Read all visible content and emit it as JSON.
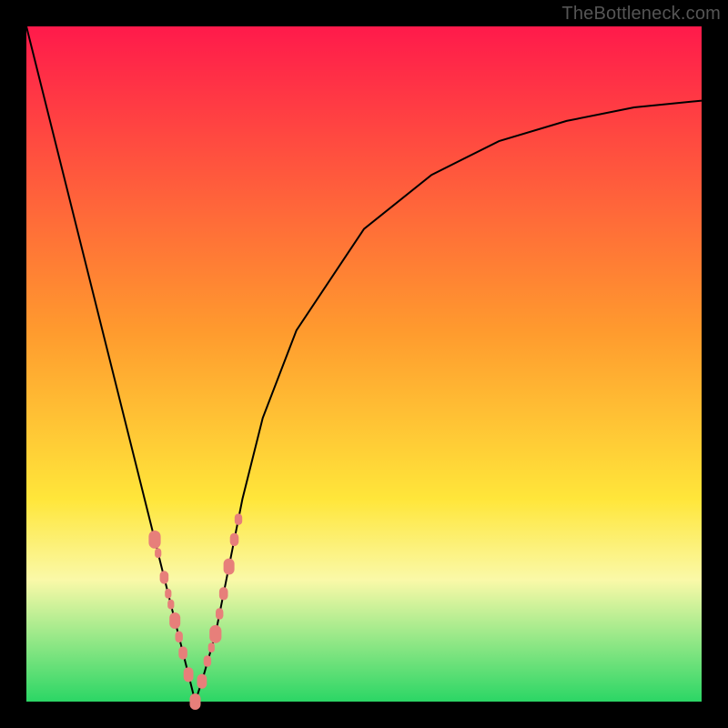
{
  "watermark": "TheBottleneck.com",
  "colors": {
    "top": "#ff1a4b",
    "orange": "#ff9a2e",
    "yellow": "#ffe63a",
    "lightyellow": "#faf9a8",
    "green": "#2bd665",
    "marker": "#e77f7a",
    "curve": "#000000"
  },
  "chart_data": {
    "type": "line",
    "title": "",
    "xlabel": "",
    "ylabel": "",
    "xlim": [
      0,
      100
    ],
    "ylim": [
      0,
      100
    ],
    "x_min_point": 25,
    "series": [
      {
        "name": "bottleneck-curve",
        "x": [
          0,
          5,
          10,
          14,
          18,
          20,
          22,
          24,
          25,
          26,
          28,
          30,
          32,
          35,
          40,
          50,
          60,
          70,
          80,
          90,
          100
        ],
        "values": [
          100,
          80,
          60,
          44,
          28,
          20,
          12,
          4,
          0,
          3,
          10,
          20,
          30,
          42,
          55,
          70,
          78,
          83,
          86,
          88,
          89
        ]
      }
    ],
    "markers": {
      "name": "highlighted-points",
      "x": [
        19.0,
        19.5,
        20.4,
        21.0,
        21.4,
        22.0,
        22.6,
        23.2,
        24.0,
        25.0,
        26.0,
        26.8,
        27.4,
        28.0,
        28.6,
        29.2,
        30.0,
        30.8,
        31.4
      ],
      "values": [
        24.0,
        22.0,
        18.4,
        16.0,
        14.4,
        12.0,
        9.6,
        7.2,
        4.0,
        0.0,
        3.0,
        6.0,
        8.0,
        10.0,
        13.0,
        16.0,
        20.0,
        24.0,
        27.0
      ],
      "sizes": [
        11,
        6,
        8,
        6,
        6,
        10,
        7,
        8,
        9,
        10,
        9,
        7,
        6,
        11,
        7,
        8,
        10,
        8,
        7
      ]
    }
  }
}
